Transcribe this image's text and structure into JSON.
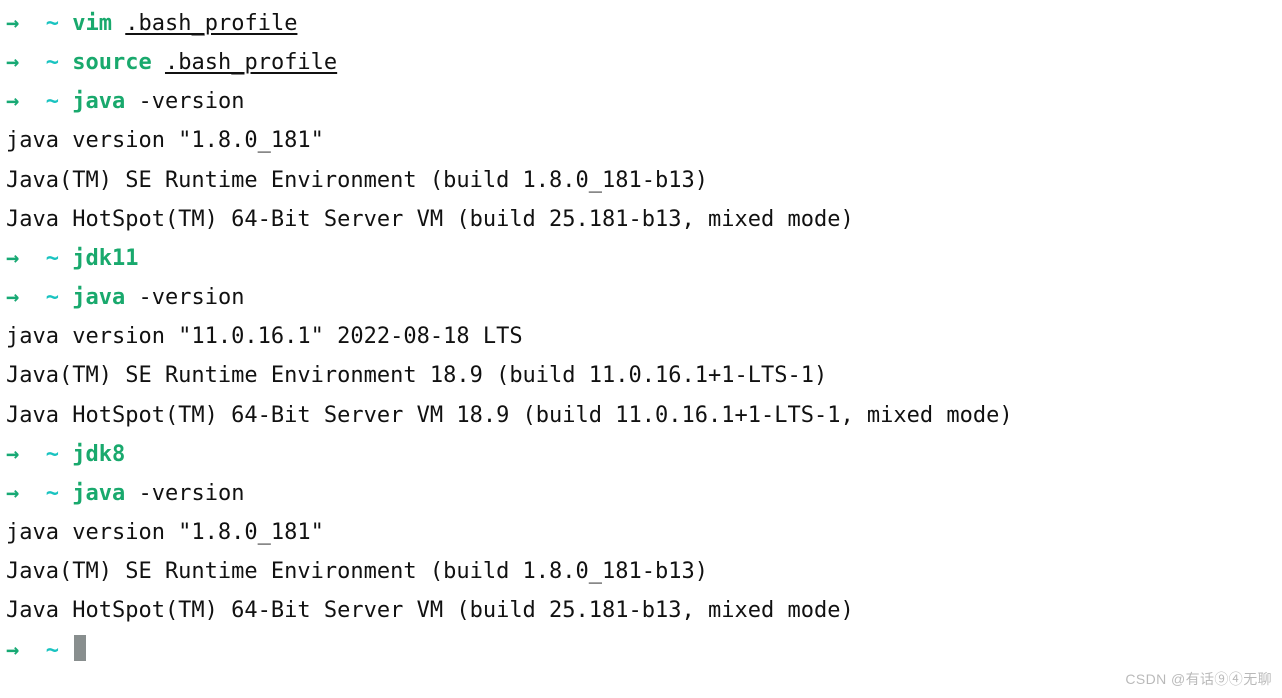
{
  "prompt": {
    "arrow": "→",
    "tilde": "~"
  },
  "lines": [
    {
      "t": "prompt",
      "cmd": "vim",
      "args": [
        {
          "text": ".bash_profile",
          "ul": true
        }
      ]
    },
    {
      "t": "prompt",
      "cmd": "source",
      "args": [
        {
          "text": ".bash_profile",
          "ul": true
        }
      ]
    },
    {
      "t": "prompt",
      "cmd": "java",
      "args": [
        {
          "text": "-version"
        }
      ]
    },
    {
      "t": "out",
      "text": "java version \"1.8.0_181\""
    },
    {
      "t": "out",
      "text": "Java(TM) SE Runtime Environment (build 1.8.0_181-b13)"
    },
    {
      "t": "out",
      "text": "Java HotSpot(TM) 64-Bit Server VM (build 25.181-b13, mixed mode)"
    },
    {
      "t": "prompt",
      "cmd": "jdk11"
    },
    {
      "t": "prompt",
      "cmd": "java",
      "args": [
        {
          "text": "-version"
        }
      ]
    },
    {
      "t": "out",
      "text": "java version \"11.0.16.1\" 2022-08-18 LTS"
    },
    {
      "t": "out",
      "text": "Java(TM) SE Runtime Environment 18.9 (build 11.0.16.1+1-LTS-1)"
    },
    {
      "t": "out",
      "text": "Java HotSpot(TM) 64-Bit Server VM 18.9 (build 11.0.16.1+1-LTS-1, mixed mode)"
    },
    {
      "t": "prompt",
      "cmd": "jdk8"
    },
    {
      "t": "prompt",
      "cmd": "java",
      "args": [
        {
          "text": "-version"
        }
      ]
    },
    {
      "t": "out",
      "text": "java version \"1.8.0_181\""
    },
    {
      "t": "out",
      "text": "Java(TM) SE Runtime Environment (build 1.8.0_181-b13)"
    },
    {
      "t": "out",
      "text": "Java HotSpot(TM) 64-Bit Server VM (build 25.181-b13, mixed mode)"
    },
    {
      "t": "prompt",
      "cursor": true
    }
  ],
  "watermark": "CSDN @有话⑨④无聊"
}
